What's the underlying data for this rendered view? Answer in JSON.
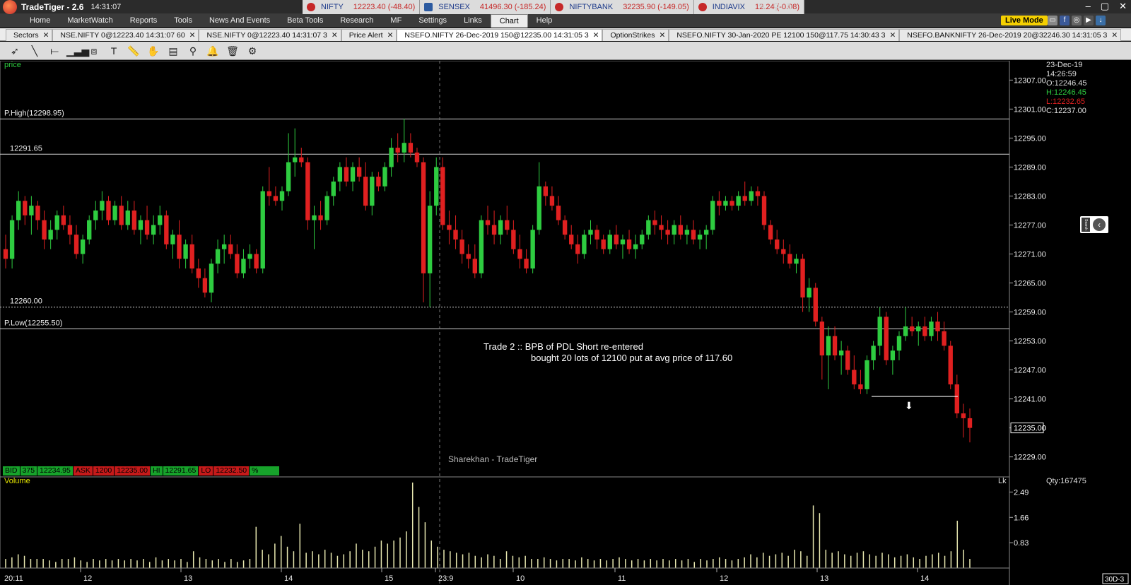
{
  "app": {
    "title": "TradeTiger - 2.6",
    "time": "14:31:07",
    "live_mode": "Live Mode"
  },
  "tickers": [
    {
      "symbol": "NIFTY",
      "value": "12223.40 (-48.40)"
    },
    {
      "symbol": "SENSEX",
      "value": "41496.30 (-185.24)"
    },
    {
      "symbol": "NIFTYBANK",
      "value": "32235.90 (-149.05)"
    },
    {
      "symbol": "INDIAVIX",
      "value": "12.24 (-0.08)"
    }
  ],
  "menu": [
    "Home",
    "MarketWatch",
    "Reports",
    "Tools",
    "News And Events",
    "Beta Tools",
    "Research",
    "MF",
    "Settings",
    "Links",
    "Chart",
    "Help"
  ],
  "active_menu": "Chart",
  "tabs": [
    {
      "label": "Sectors",
      "active": false
    },
    {
      "label": "NSE.NIFTY 0@12223.40 14:31:07 60",
      "active": false
    },
    {
      "label": "NSE.NIFTY 0@12223.40 14:31:07 3",
      "active": false
    },
    {
      "label": "Price Alert",
      "active": false
    },
    {
      "label": "NSEFO.NIFTY 26-Dec-2019 150@12235.00 14:31:05 3",
      "active": true
    },
    {
      "label": "OptionStrikes",
      "active": false
    },
    {
      "label": "NSEFO.NIFTY 30-Jan-2020 PE 12100 150@117.75 14:30:43 3",
      "active": false
    },
    {
      "label": "NSEFO.BANKNIFTY 26-Dec-2019 20@32246.30 14:31:05 3",
      "active": false
    }
  ],
  "chart_meta": {
    "price_label": "price",
    "date": "23-Dec-19",
    "time": "14:26:59",
    "open": "O:12246.45",
    "high": "H:12246.45",
    "low": "L:12232.65",
    "close": "C:12237.00",
    "qty": "Qty:167475",
    "volume_label": "Volume",
    "lk": "Lk",
    "watermark": "Sharekhan - TradeTiger",
    "annotation_line1": "Trade 2 :: BPB of PDL Short re-entered",
    "annotation_line2": "bought 20 lots of 12100 put at avg price of 117.60",
    "bid": [
      "BID",
      "375",
      "12234.95"
    ],
    "ask": [
      "ASK",
      "1200",
      "12235.00"
    ],
    "hi": [
      "HI",
      "12291.65"
    ],
    "lo": [
      "LO",
      "12232.50"
    ],
    "pct": "%",
    "period": "30D-3",
    "colors": {
      "up": "#2ecc40",
      "down": "#e02020",
      "volume": "#e8e8b0",
      "hline": "#cfcfcf"
    }
  },
  "chart_data": {
    "type": "candlestick",
    "price_axis": {
      "min": 12225,
      "max": 12311,
      "ticks": [
        "12307.00",
        "12301.00",
        "12295.00",
        "12289.00",
        "12283.00",
        "12277.00",
        "12271.00",
        "12265.00",
        "12259.00",
        "12253.00",
        "12247.00",
        "12241.00",
        "12235.00",
        "12229.00"
      ],
      "current": "12235.00"
    },
    "volume_axis": {
      "max": 2.8,
      "ticks": [
        "2.49",
        "1.66",
        "0.83"
      ]
    },
    "x_labels": [
      "20:11",
      "12",
      "13",
      "14",
      "15",
      "23:9",
      "10",
      "11",
      "12",
      "13",
      "14"
    ],
    "hlines": [
      {
        "label": "P.High(12298.95)",
        "value": 12298.95
      },
      {
        "label": "12291.65",
        "value": 12291.65
      },
      {
        "label": "12260.00",
        "value": 12260.0,
        "dotted": true
      },
      {
        "label": "P.Low(12255.50)",
        "value": 12255.5
      }
    ],
    "candles": [
      [
        12272.0,
        12275.0,
        12268.0,
        12270.0
      ],
      [
        12270.0,
        12279.0,
        12268.0,
        12278.0
      ],
      [
        12278.0,
        12284.0,
        12276.0,
        12282.0
      ],
      [
        12282.0,
        12283.0,
        12277.0,
        12279.0
      ],
      [
        12279.0,
        12283.0,
        12275.0,
        12281.0
      ],
      [
        12281.0,
        12282.0,
        12276.0,
        12278.0
      ],
      [
        12278.0,
        12280.0,
        12272.0,
        12274.0
      ],
      [
        12274.0,
        12278.0,
        12272.0,
        12276.0
      ],
      [
        12276.0,
        12280.0,
        12274.0,
        12279.0
      ],
      [
        12279.0,
        12281.0,
        12276.0,
        12277.0
      ],
      [
        12277.0,
        12279.0,
        12273.0,
        12275.0
      ],
      [
        12275.0,
        12277.0,
        12270.0,
        12271.0
      ],
      [
        12271.0,
        12275.0,
        12269.0,
        12274.0
      ],
      [
        12274.0,
        12279.0,
        12273.0,
        12278.0
      ],
      [
        12278.0,
        12282.0,
        12276.0,
        12280.0
      ],
      [
        12280.0,
        12284.0,
        12278.0,
        12282.0
      ],
      [
        12282.0,
        12283.0,
        12277.0,
        12278.0
      ],
      [
        12278.0,
        12282.0,
        12277.0,
        12281.0
      ],
      [
        12281.0,
        12283.0,
        12276.0,
        12277.0
      ],
      [
        12277.0,
        12282.0,
        12276.0,
        12280.0
      ],
      [
        12280.0,
        12282.0,
        12275.0,
        12276.0
      ],
      [
        12276.0,
        12279.0,
        12273.0,
        12278.0
      ],
      [
        12278.0,
        12281.0,
        12274.0,
        12275.0
      ],
      [
        12275.0,
        12279.0,
        12273.0,
        12277.0
      ],
      [
        12277.0,
        12281.0,
        12275.0,
        12279.0
      ],
      [
        12279.0,
        12280.0,
        12272.0,
        12273.0
      ],
      [
        12273.0,
        12276.0,
        12270.0,
        12275.0
      ],
      [
        12275.0,
        12278.0,
        12268.0,
        12270.0
      ],
      [
        12270.0,
        12274.0,
        12268.0,
        12273.0
      ],
      [
        12273.0,
        12275.0,
        12267.0,
        12268.0
      ],
      [
        12268.0,
        12270.0,
        12264.0,
        12266.0
      ],
      [
        12266.0,
        12268.0,
        12262.0,
        12263.0
      ],
      [
        12263.0,
        12270.0,
        12261.0,
        12269.0
      ],
      [
        12269.0,
        12274.0,
        12267.0,
        12272.0
      ],
      [
        12272.0,
        12275.0,
        12269.0,
        12273.0
      ],
      [
        12273.0,
        12275.0,
        12270.0,
        12271.0
      ],
      [
        12271.0,
        12273.0,
        12266.0,
        12267.0
      ],
      [
        12267.0,
        12272.0,
        12266.0,
        12270.0
      ],
      [
        12270.0,
        12273.0,
        12268.0,
        12271.0
      ],
      [
        12271.0,
        12272.0,
        12267.0,
        12268.0
      ],
      [
        12268.0,
        12285.0,
        12267.0,
        12284.0
      ],
      [
        12284.0,
        12289.0,
        12281.0,
        12283.0
      ],
      [
        12283.0,
        12285.0,
        12281.0,
        12282.0
      ],
      [
        12282.0,
        12285.0,
        12280.0,
        12284.0
      ],
      [
        12284.0,
        12296.0,
        12283.0,
        12290.0
      ],
      [
        12290.0,
        12297.0,
        12287.0,
        12291.0
      ],
      [
        12291.0,
        12293.0,
        12289.0,
        12290.0
      ],
      [
        12290.0,
        12291.0,
        12276.0,
        12278.0
      ],
      [
        12278.0,
        12281.0,
        12272.0,
        12279.0
      ],
      [
        12279.0,
        12282.0,
        12276.0,
        12278.0
      ],
      [
        12278.0,
        12284.0,
        12277.0,
        12283.0
      ],
      [
        12283.0,
        12287.0,
        12281.0,
        12286.0
      ],
      [
        12286.0,
        12290.0,
        12284.0,
        12289.0
      ],
      [
        12289.0,
        12291.0,
        12285.0,
        12286.0
      ],
      [
        12286.0,
        12290.0,
        12284.0,
        12289.0
      ],
      [
        12289.0,
        12291.0,
        12286.0,
        12287.0
      ],
      [
        12287.0,
        12290.0,
        12280.0,
        12281.0
      ],
      [
        12281.0,
        12288.0,
        12279.0,
        12287.0
      ],
      [
        12287.0,
        12288.0,
        12284.0,
        12285.0
      ],
      [
        12285.0,
        12290.0,
        12284.0,
        12289.0
      ],
      [
        12289.0,
        12295.0,
        12287.0,
        12293.0
      ],
      [
        12293.0,
        12296.0,
        12290.0,
        12292.0
      ],
      [
        12292.0,
        12299.0,
        12290.0,
        12294.0
      ],
      [
        12294.0,
        12296.0,
        12291.0,
        12292.0
      ],
      [
        12292.0,
        12293.0,
        12289.0,
        12290.0
      ],
      [
        12290.0,
        12291.0,
        12261.0,
        12267.0
      ],
      [
        12267.0,
        12284.0,
        12260.0,
        12281.0
      ],
      [
        12281.0,
        12291.0,
        12279.0,
        12289.0
      ],
      [
        12289.0,
        12291.0,
        12276.0,
        12277.0
      ],
      [
        12277.0,
        12280.0,
        12273.0,
        12276.0
      ],
      [
        12276.0,
        12279.0,
        12272.0,
        12274.0
      ],
      [
        12274.0,
        12276.0,
        12269.0,
        12271.0
      ],
      [
        12271.0,
        12273.0,
        12268.0,
        12270.0
      ],
      [
        12270.0,
        12273.0,
        12266.0,
        12267.0
      ],
      [
        12267.0,
        12279.0,
        12266.0,
        12278.0
      ],
      [
        12278.0,
        12281.0,
        12275.0,
        12277.0
      ],
      [
        12277.0,
        12280.0,
        12273.0,
        12275.0
      ],
      [
        12275.0,
        12279.0,
        12273.0,
        12278.0
      ],
      [
        12278.0,
        12281.0,
        12275.0,
        12276.0
      ],
      [
        12276.0,
        12278.0,
        12271.0,
        12272.0
      ],
      [
        12272.0,
        12275.0,
        12268.0,
        12270.0
      ],
      [
        12270.0,
        12272.0,
        12267.0,
        12268.0
      ],
      [
        12268.0,
        12277.0,
        12267.0,
        12276.0
      ],
      [
        12276.0,
        12290.0,
        12275.0,
        12285.0
      ],
      [
        12285.0,
        12286.0,
        12281.0,
        12283.0
      ],
      [
        12283.0,
        12285.0,
        12280.0,
        12281.0
      ],
      [
        12281.0,
        12283.0,
        12277.0,
        12278.0
      ],
      [
        12278.0,
        12279.0,
        12274.0,
        12275.0
      ],
      [
        12275.0,
        12277.0,
        12272.0,
        12273.0
      ],
      [
        12273.0,
        12275.0,
        12269.0,
        12271.0
      ],
      [
        12271.0,
        12276.0,
        12270.0,
        12275.0
      ],
      [
        12275.0,
        12278.0,
        12273.0,
        12276.0
      ],
      [
        12276.0,
        12277.0,
        12272.0,
        12274.0
      ],
      [
        12274.0,
        12275.0,
        12271.0,
        12272.0
      ],
      [
        12272.0,
        12276.0,
        12271.0,
        12275.0
      ],
      [
        12275.0,
        12277.0,
        12272.0,
        12273.0
      ],
      [
        12273.0,
        12275.0,
        12270.0,
        12274.0
      ],
      [
        12274.0,
        12276.0,
        12271.0,
        12272.0
      ],
      [
        12272.0,
        12275.0,
        12270.0,
        12273.0
      ],
      [
        12273.0,
        12276.0,
        12272.0,
        12275.0
      ],
      [
        12275.0,
        12279.0,
        12274.0,
        12278.0
      ],
      [
        12278.0,
        12280.0,
        12275.0,
        12277.0
      ],
      [
        12277.0,
        12279.0,
        12274.0,
        12276.0
      ],
      [
        12276.0,
        12278.0,
        12273.0,
        12275.0
      ],
      [
        12275.0,
        12278.0,
        12273.0,
        12277.0
      ],
      [
        12277.0,
        12279.0,
        12274.0,
        12275.0
      ],
      [
        12275.0,
        12277.0,
        12273.0,
        12276.0
      ],
      [
        12276.0,
        12278.0,
        12273.0,
        12274.0
      ],
      [
        12274.0,
        12276.0,
        12272.0,
        12275.0
      ],
      [
        12275.0,
        12277.0,
        12272.0,
        12276.0
      ],
      [
        12276.0,
        12283.0,
        12275.0,
        12282.0
      ],
      [
        12282.0,
        12284.0,
        12279.0,
        12281.0
      ],
      [
        12281.0,
        12283.0,
        12280.0,
        12282.0
      ],
      [
        12282.0,
        12283.0,
        12280.0,
        12281.0
      ],
      [
        12281.0,
        12284.0,
        12280.0,
        12283.0
      ],
      [
        12283.0,
        12286.0,
        12281.0,
        12282.0
      ],
      [
        12282.0,
        12285.0,
        12281.0,
        12284.0
      ],
      [
        12284.0,
        12285.0,
        12281.0,
        12283.0
      ],
      [
        12283.0,
        12284.0,
        12276.0,
        12277.0
      ],
      [
        12277.0,
        12278.0,
        12273.0,
        12274.0
      ],
      [
        12274.0,
        12276.0,
        12271.0,
        12272.0
      ],
      [
        12272.0,
        12274.0,
        12269.0,
        12271.0
      ],
      [
        12271.0,
        12273.0,
        12268.0,
        12269.0
      ],
      [
        12269.0,
        12271.0,
        12267.0,
        12270.0
      ],
      [
        12270.0,
        12271.0,
        12259.0,
        12262.0
      ],
      [
        12262.0,
        12266.0,
        12259.0,
        12264.0
      ],
      [
        12264.0,
        12265.0,
        12256.0,
        12257.0
      ],
      [
        12257.0,
        12258.0,
        12245.0,
        12250.0
      ],
      [
        12250.0,
        12256.0,
        12243.0,
        12254.0
      ],
      [
        12254.0,
        12256.0,
        12249.0,
        12250.0
      ],
      [
        12250.0,
        12253.0,
        12246.0,
        12251.0
      ],
      [
        12251.0,
        12252.0,
        12246.0,
        12247.0
      ],
      [
        12247.0,
        12250.0,
        12243.0,
        12244.0
      ],
      [
        12244.0,
        12247.0,
        12242.0,
        12243.0
      ],
      [
        12243.0,
        12250.0,
        12242.0,
        12249.0
      ],
      [
        12249.0,
        12253.0,
        12247.0,
        12252.0
      ],
      [
        12252.0,
        12260.0,
        12250.0,
        12258.0
      ],
      [
        12258.0,
        12259.0,
        12248.0,
        12249.0
      ],
      [
        12249.0,
        12252.0,
        12246.0,
        12251.0
      ],
      [
        12251.0,
        12255.0,
        12249.0,
        12254.0
      ],
      [
        12254.0,
        12260.0,
        12253.0,
        12256.0
      ],
      [
        12256.0,
        12258.0,
        12254.0,
        12255.0
      ],
      [
        12255.0,
        12257.0,
        12252.0,
        12256.0
      ],
      [
        12256.0,
        12258.0,
        12253.0,
        12254.0
      ],
      [
        12254.0,
        12258.0,
        12253.0,
        12257.0
      ],
      [
        12257.0,
        12259.0,
        12253.0,
        12255.0
      ],
      [
        12255.0,
        12257.0,
        12251.0,
        12252.0
      ],
      [
        12252.0,
        12253.0,
        12243.0,
        12244.0
      ],
      [
        12244.0,
        12246.0,
        12237.0,
        12238.0
      ],
      [
        12238.0,
        12240.0,
        12233.0,
        12237.0
      ],
      [
        12237.0,
        12239.0,
        12232.0,
        12235.0
      ]
    ],
    "volumes": [
      0.3,
      0.35,
      0.45,
      0.4,
      0.3,
      0.3,
      0.3,
      0.25,
      0.2,
      0.3,
      0.3,
      0.35,
      0.25,
      0.2,
      0.3,
      0.25,
      0.3,
      0.25,
      0.3,
      0.25,
      0.3,
      0.25,
      0.3,
      0.2,
      0.35,
      0.25,
      0.3,
      0.25,
      0.3,
      0.2,
      0.55,
      0.35,
      0.3,
      0.25,
      0.3,
      0.2,
      0.3,
      0.2,
      0.25,
      0.3,
      1.35,
      0.6,
      0.45,
      0.8,
      1.05,
      0.7,
      0.55,
      1.45,
      0.5,
      0.55,
      0.45,
      0.6,
      0.5,
      0.4,
      0.45,
      0.55,
      0.8,
      0.6,
      0.55,
      0.7,
      0.9,
      0.8,
      0.9,
      1.0,
      1.2,
      2.8,
      2.0,
      1.5,
      0.9,
      0.7,
      0.6,
      0.55,
      0.5,
      0.45,
      0.5,
      0.4,
      0.35,
      0.45,
      0.4,
      0.3,
      0.55,
      0.4,
      0.35,
      0.4,
      0.3,
      0.3,
      0.35,
      0.3,
      0.25,
      0.3,
      0.3,
      0.25,
      0.35,
      0.3,
      0.25,
      0.3,
      0.25,
      0.3,
      0.35,
      0.3,
      0.25,
      0.3,
      0.25,
      0.3,
      0.25,
      0.3,
      0.25,
      0.3,
      0.25,
      0.3,
      0.2,
      0.3,
      0.25,
      0.3,
      0.35,
      0.3,
      0.25,
      0.3,
      0.35,
      0.45,
      0.35,
      0.5,
      0.4,
      0.45,
      0.5,
      0.4,
      0.6,
      0.55,
      0.4,
      2.05,
      1.8,
      0.6,
      0.5,
      0.55,
      0.45,
      0.4,
      0.5,
      0.55,
      0.45,
      0.4,
      0.5,
      0.45,
      0.35,
      0.4,
      0.45,
      0.35,
      0.3,
      0.4,
      0.45,
      0.5,
      0.4,
      0.55,
      1.55,
      0.6,
      0.3
    ]
  }
}
